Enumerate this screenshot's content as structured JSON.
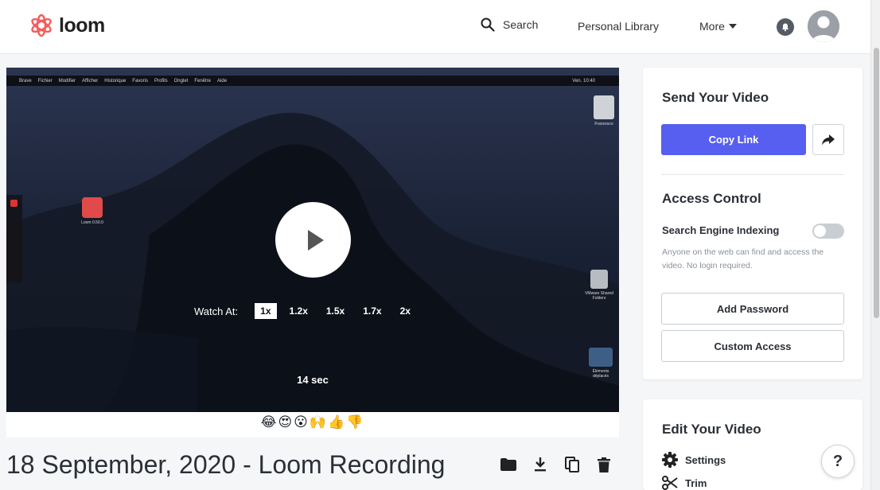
{
  "brand": {
    "name": "loom",
    "color": "#f55b5b"
  },
  "header": {
    "search_label": "Search",
    "personal_library": "Personal Library",
    "more": "More"
  },
  "video": {
    "menubar_items": [
      "Brave",
      "Fichier",
      "Modifier",
      "Afficher",
      "Historique",
      "Favoris",
      "Profils",
      "Onglet",
      "Fenêtre",
      "Aide"
    ],
    "menubar_clock": "Ven. 10:40",
    "desktop_icons": {
      "loom_app": "Loom 0.50.0",
      "disk": "Francesco",
      "vmware": "VMware Shared Folders",
      "moved": "Éléments déplacés"
    },
    "watch_label": "Watch At:",
    "speeds": [
      "1x",
      "1.2x",
      "1.5x",
      "1.7x",
      "2x"
    ],
    "selected_speed": "1x",
    "duration": "14 sec"
  },
  "reactions": "😂😍😮🙌👍👎",
  "title": "18 September, 2020 - Loom Recording",
  "send_panel": {
    "title": "Send Your Video",
    "copy_link": "Copy Link",
    "access_title": "Access Control",
    "indexing_label": "Search Engine Indexing",
    "indexing_on": false,
    "indexing_desc": "Anyone on the web can find and access the video. No login required.",
    "add_password": "Add Password",
    "custom_access": "Custom Access"
  },
  "edit_panel": {
    "title": "Edit Your Video",
    "settings": "Settings",
    "trim": "Trim"
  },
  "help": "?",
  "accent_color": "#565ff0"
}
